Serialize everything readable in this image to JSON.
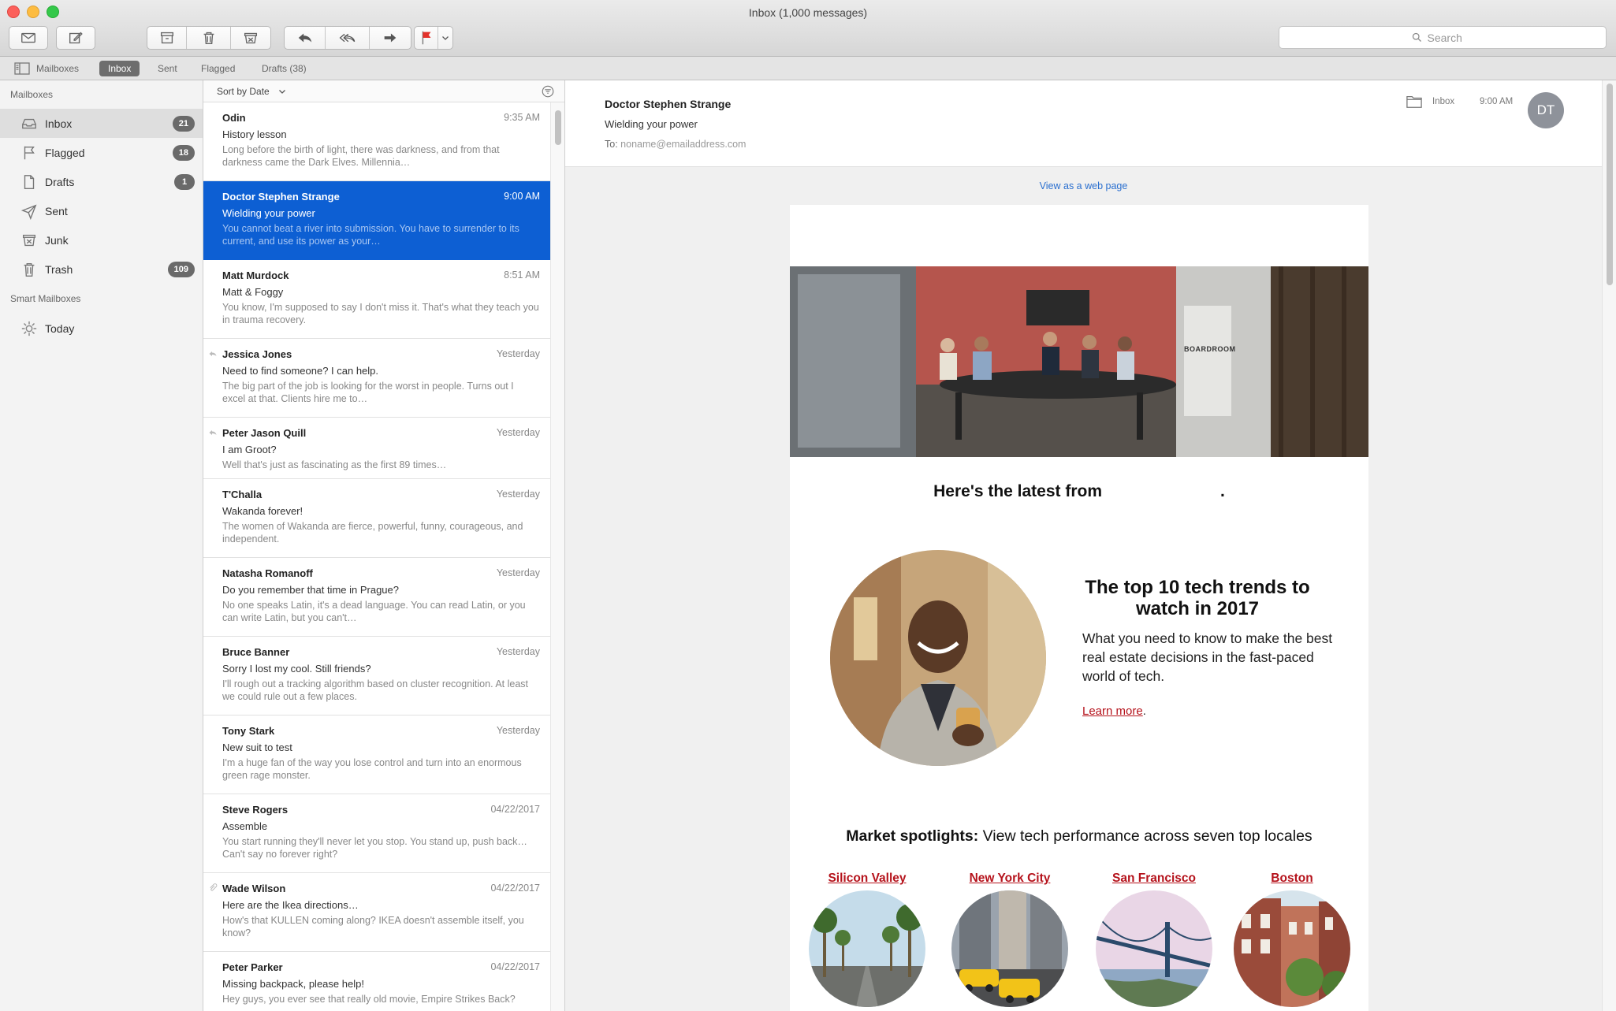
{
  "window": {
    "title": "Inbox (1,000 messages)"
  },
  "toolbar": {
    "search_placeholder": "Search",
    "icons": [
      "get-mail-icon",
      "compose-icon",
      "archive-icon",
      "trash-icon",
      "junk-icon",
      "reply-icon",
      "reply-all-icon",
      "forward-icon",
      "flag-icon",
      "chevron-down-icon",
      "search-icon"
    ],
    "flag_color": "#e3322b"
  },
  "favorites": {
    "mailboxes": "Mailboxes",
    "inbox": "Inbox",
    "sent": "Sent",
    "flagged": "Flagged",
    "drafts": "Drafts (38)"
  },
  "sidebar": {
    "heading": "Mailboxes",
    "items": [
      {
        "label": "Inbox",
        "badge": "21",
        "icon": "inbox-icon"
      },
      {
        "label": "Flagged",
        "badge": "18",
        "icon": "flag-icon"
      },
      {
        "label": "Drafts",
        "badge": "1",
        "icon": "document-icon"
      },
      {
        "label": "Sent",
        "badge": "",
        "icon": "paper-plane-icon"
      },
      {
        "label": "Junk",
        "badge": "",
        "icon": "junk-icon"
      },
      {
        "label": "Trash",
        "badge": "109",
        "icon": "trash-icon"
      }
    ],
    "smart_heading": "Smart Mailboxes",
    "smart_items": [
      {
        "label": "Today",
        "icon": "gear-icon"
      }
    ]
  },
  "list": {
    "sort_label": "Sort by Date",
    "messages": [
      {
        "from": "Odin",
        "time": "9:35 AM",
        "subject": "History lesson",
        "preview": "Long before the birth of light, there was darkness, and from that darkness came the Dark Elves. Millennia…"
      },
      {
        "from": "Doctor Stephen Strange",
        "time": "9:00 AM",
        "subject": "Wielding your power",
        "preview": "You cannot beat a river into submission. You have to surrender to its current, and use its power as your…"
      },
      {
        "from": "Matt Murdock",
        "time": "8:51 AM",
        "subject": "Matt & Foggy",
        "preview": "You know, I'm supposed to say I don't miss it. That's what they teach you in trauma recovery."
      },
      {
        "from": "Jessica Jones",
        "time": "Yesterday",
        "subject": "Need to find someone? I can help.",
        "preview": "The big part of the job is looking for the worst in people. Turns out I excel at that. Clients hire me to…"
      },
      {
        "from": "Peter Jason Quill",
        "time": "Yesterday",
        "subject": "I am Groot?",
        "preview": "Well that's just as fascinating as the first 89 times…"
      },
      {
        "from": "T'Challa",
        "time": "Yesterday",
        "subject": "Wakanda forever!",
        "preview": "The women of Wakanda are fierce, powerful, funny, courageous, and independent."
      },
      {
        "from": "Natasha Romanoff",
        "time": "Yesterday",
        "subject": "Do you remember that time in Prague?",
        "preview": "No one speaks Latin, it's a dead language. You can read Latin, or you can write Latin, but you can't…"
      },
      {
        "from": "Bruce Banner",
        "time": "Yesterday",
        "subject": "Sorry I lost my cool. Still friends?",
        "preview": "I'll rough out a tracking algorithm based on cluster recognition. At least we could rule out a few places."
      },
      {
        "from": "Tony Stark",
        "time": "Yesterday",
        "subject": "New suit to test",
        "preview": "I'm a huge fan of the way you lose control and turn into an enormous green rage monster."
      },
      {
        "from": "Steve Rogers",
        "time": "04/22/2017",
        "subject": "Assemble",
        "preview": "You start running they'll never let you stop. You stand up, push back… Can't say no forever right?"
      },
      {
        "from": "Wade Wilson",
        "time": "04/22/2017",
        "subject": "Here are the Ikea directions…",
        "preview": "How's that KULLEN coming along? IKEA doesn't assemble itself, you know?"
      },
      {
        "from": "Peter Parker",
        "time": "04/22/2017",
        "subject": "Missing backpack, please help!",
        "preview": "Hey guys, you ever see that really old movie, Empire Strikes Back?"
      }
    ]
  },
  "reader": {
    "from": "Doctor Stephen Strange",
    "subject": "Wielding your power",
    "to_label": "To:",
    "to_address": "noname@emailaddress.com",
    "folder": "Inbox",
    "time": "9:00 AM",
    "avatar_initials": "DT",
    "web_link": "View as a web page",
    "email": {
      "latest": "Here's the latest from",
      "latest_end": ".",
      "article_title": "The top 10 tech trends to watch in 2017",
      "article_body": "What you need to know to make the best real estate decisions in the fast-paced world of tech.",
      "learn_more": "Learn more",
      "learn_more_end": ".",
      "spotlight_bold": "Market spotlights:",
      "spotlight_rest": " View tech performance across seven top locales",
      "cities": [
        "Silicon Valley",
        "New York City",
        "San Francisco",
        "Boston"
      ],
      "hero_sign": "BOARDROOM",
      "link_color": "#b5121b"
    }
  }
}
